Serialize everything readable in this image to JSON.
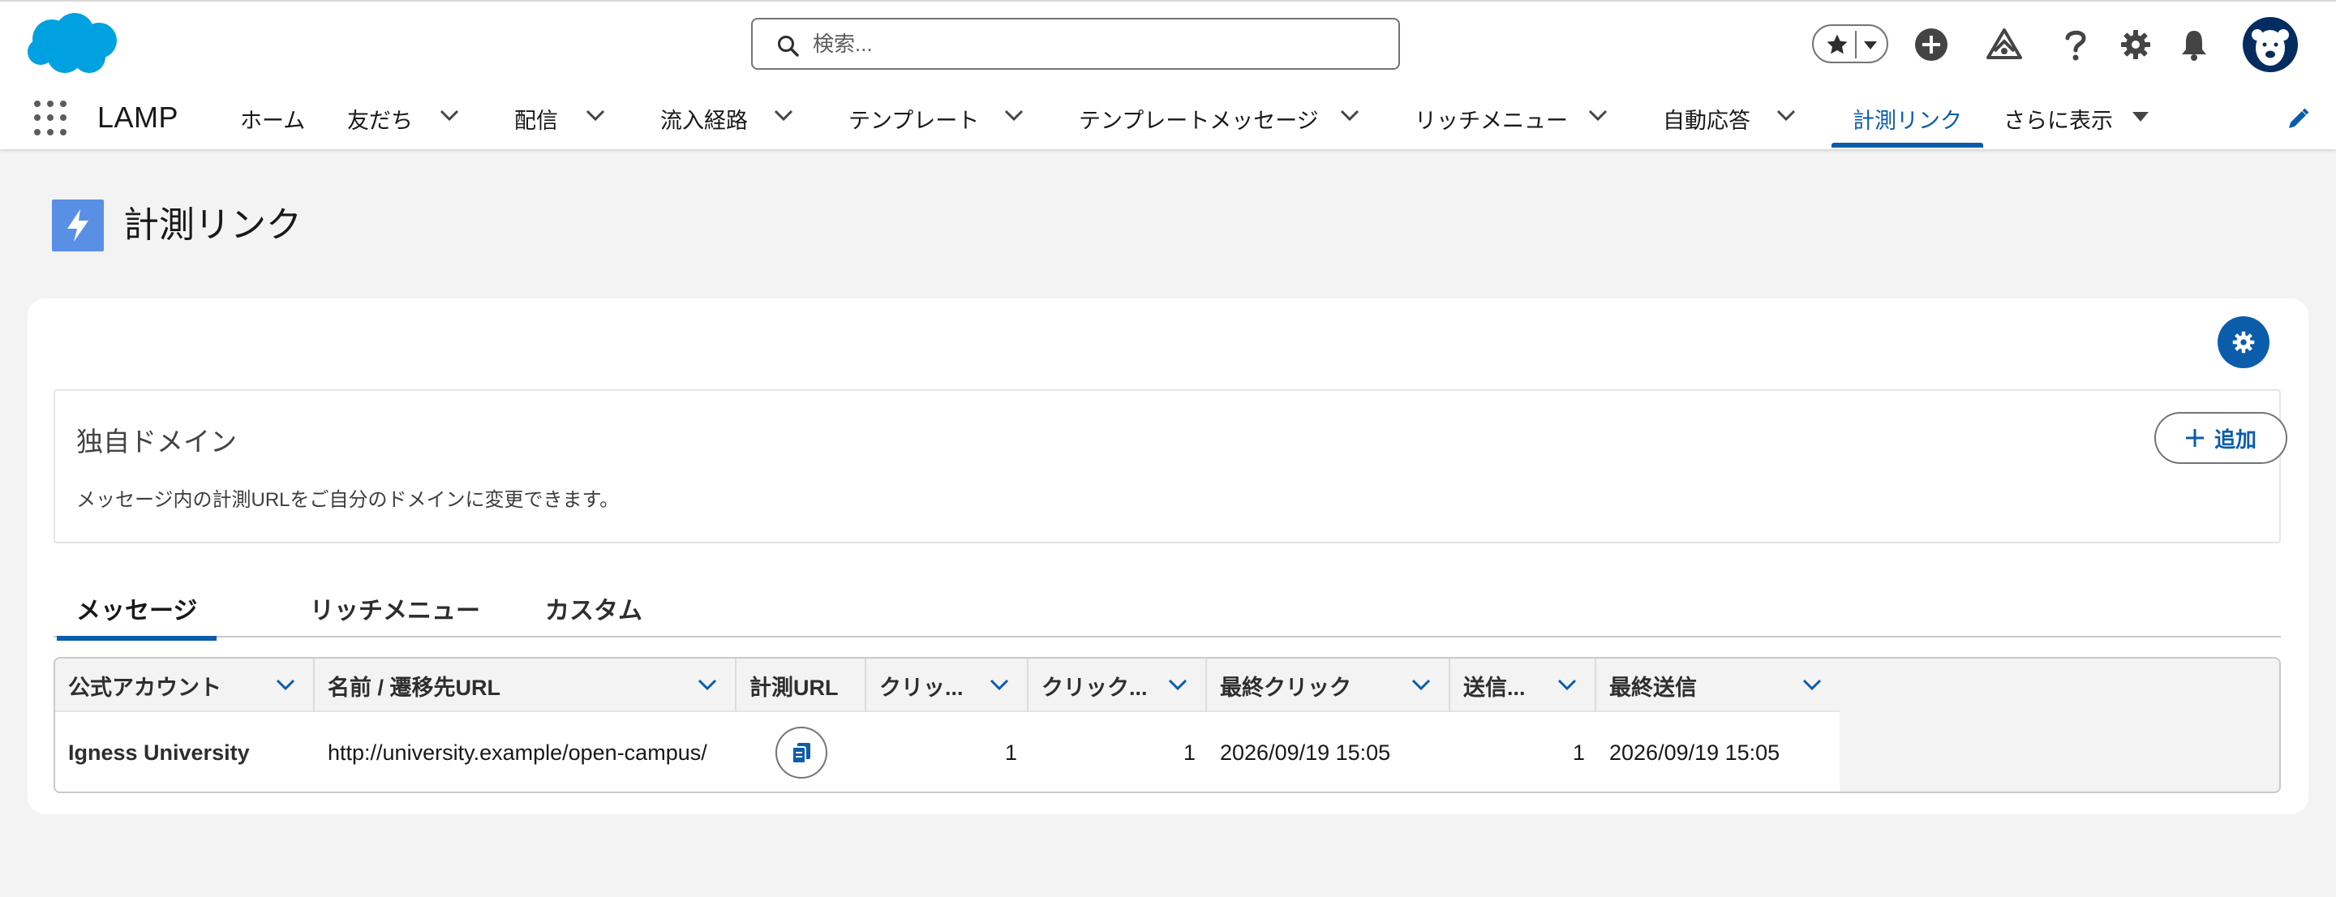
{
  "header": {
    "search_placeholder": "検索...",
    "avatar_alt": "user-avatar"
  },
  "appbar": {
    "app_name": "LAMP",
    "nav": [
      {
        "label": "ホーム",
        "has_menu": false
      },
      {
        "label": "友だち",
        "has_menu": true
      },
      {
        "label": "配信",
        "has_menu": true
      },
      {
        "label": "流入経路",
        "has_menu": true
      },
      {
        "label": "テンプレート",
        "has_menu": true
      },
      {
        "label": "テンプレートメッセージ",
        "has_menu": true
      },
      {
        "label": "リッチメニュー",
        "has_menu": true
      },
      {
        "label": "自動応答",
        "has_menu": true
      },
      {
        "label": "計測リンク",
        "has_menu": false,
        "active": true
      },
      {
        "label": "さらに表示",
        "has_menu": true
      }
    ]
  },
  "page": {
    "title": "計測リンク"
  },
  "domain": {
    "title": "独自ドメイン",
    "description": "メッセージ内の計測URLをご自分のドメインに変更できます。",
    "add_label": "追加"
  },
  "tabs": [
    {
      "label": "メッセージ",
      "active": true
    },
    {
      "label": "リッチメニュー",
      "active": false
    },
    {
      "label": "カスタム",
      "active": false
    }
  ],
  "table": {
    "columns": [
      "公式アカウント",
      "名前 / 遷移先URL",
      "計測URL",
      "クリッ...",
      "クリック...",
      "最終クリック",
      "送信...",
      "最終送信"
    ],
    "rows": [
      {
        "account": "Igness University",
        "url": "http://university.example/open-campus/",
        "clicks": "1",
        "click_users": "1",
        "last_click": "2026/09/19 15:05",
        "sent": "1",
        "last_sent": "2026/09/19 15:05"
      }
    ]
  },
  "colors": {
    "brand_blue": "#0b5cab",
    "page_icon": "#5a8fe6",
    "salesforce_cloud": "#00a1e0"
  }
}
